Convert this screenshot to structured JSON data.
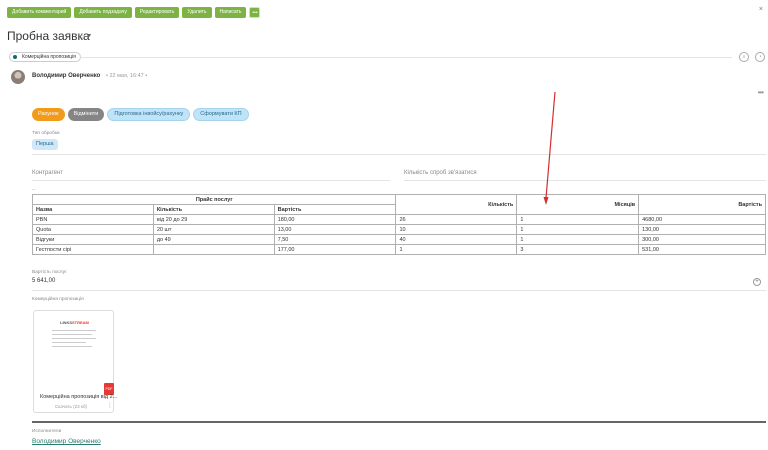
{
  "toolbar": {
    "add_comment": "Добавить комментарий",
    "add_subtask": "Добавить подзадачу",
    "edit": "Редактировать",
    "delete": "Удалить",
    "write": "Написать",
    "more": "•••"
  },
  "close": "×",
  "title": "Пробна заявка",
  "title_star": "☆",
  "title_caret": "▾",
  "tag": "Комерційна пропозиція",
  "post": {
    "author": "Володимир Оверченко",
    "date": "• 22 мая, 16:47 •"
  },
  "stages": [
    "Рахунок",
    "Відмінити",
    "Підготовка інвойсу/рахунку",
    "Сформувати КП"
  ],
  "fields": {
    "processing_type_label": "Тип обробки",
    "processing_type_value": "Перша",
    "counterparty": "Контрагент",
    "contact_attempts": "Кількість спроб зв'язатися",
    "dots": "..",
    "service_cost_label": "Вартість послуг",
    "service_cost_value": "5 641,00",
    "commercial_offer_label": "Комерційна пропозиція",
    "executors_label": "Исполнители",
    "executor_name": "Володимир Оверченко"
  },
  "price_table": {
    "group_header": "Прайс послуг",
    "headers": [
      "Назва",
      "Кількість",
      "Вартість",
      "Кількість",
      "Місяців",
      "Вартість"
    ],
    "rows": [
      [
        "PBN",
        "від 20 до 29",
        "180,00",
        "26",
        "1",
        "4680,00"
      ],
      [
        "Quota",
        "20 шт",
        "13,00",
        "10",
        "1",
        "130,00"
      ],
      [
        "Відгуки",
        "до 49",
        "7,50",
        "40",
        "1",
        "300,00"
      ],
      [
        "Гестпости сірі",
        "",
        "177,00",
        "1",
        "3",
        "531,00"
      ]
    ]
  },
  "document": {
    "logo_a": "LINKS",
    "logo_b": "STREAM",
    "name": "Комерційна пропозиція від 2...",
    "meta": "Скачать (23 кб)",
    "badge": "PDF"
  },
  "colors": {
    "toolbar_green": "#7cb342",
    "stage_orange": "#f29b1a",
    "stage_gray": "#858585",
    "stage_blue": "#bfe3f7",
    "arrow_red": "#d32f2f"
  }
}
